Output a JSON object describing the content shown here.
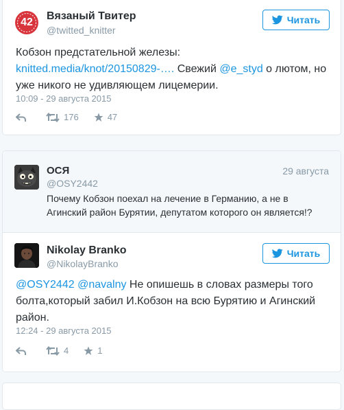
{
  "tweet1": {
    "avatar_text": "42",
    "author_name": "Вязаный Твитер",
    "author_handle": "@twitted_knitter",
    "follow_label": "Читать",
    "text_line1": "Кобзон предстательной железы:",
    "link_url": "knitted.media/knot/20150829-….",
    "text_mid": " Свежий ",
    "mention": "@e_styd",
    "text_end1": " о лютом, но",
    "text_line3": "уже никого не удивляющем лицемерии.",
    "time": "10:09 - 29 августа 2015",
    "retweets": "176",
    "likes": "47"
  },
  "quoted": {
    "author_name": "ОСЯ",
    "author_handle": "@OSY2442",
    "date": "29 августа",
    "text_line1": "Почему Кобзон поехал на лечение в Германию, а не в",
    "text_line2": "Агинский район Бурятии, депутатом которого он является!?"
  },
  "tweet2": {
    "author_name": "Nikolay Branko",
    "author_handle": "@NikolayBranko",
    "follow_label": "Читать",
    "mention1": "@OSY2442",
    "mention2": "@navalny",
    "text_end1": " Не опишешь в словах размеры того",
    "text_line2": "болта,который забил И.Кобзон на всю Бурятию и Агинский",
    "text_line3": "район.",
    "time": "12:24 - 29 августа 2015",
    "retweets": "4",
    "likes": "1"
  },
  "colors": {
    "accent": "#1b95e0",
    "badge": "#d8343b",
    "muted": "#8899a6"
  }
}
